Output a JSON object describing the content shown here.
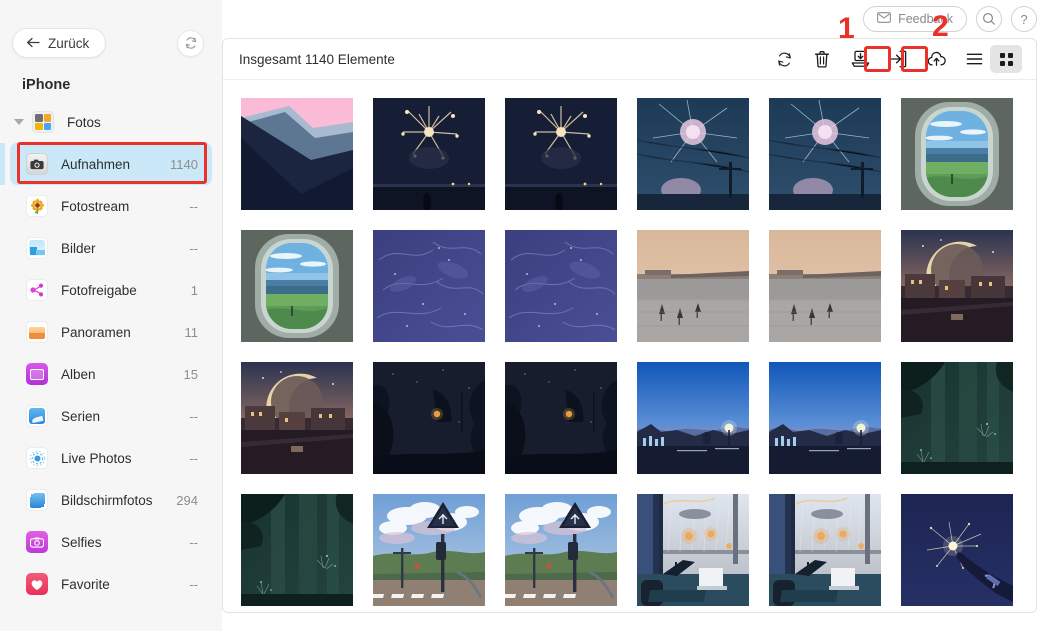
{
  "window": {
    "traffic_lights": [
      "close",
      "minimize",
      "maximize"
    ],
    "colors": {
      "close": "#fc615d",
      "minimize": "#fdbc40",
      "maximize": "#34c84a",
      "accent_selected": "#cbe8f8",
      "annotation_red": "#e8322a",
      "sidebar_bg": "#f6f6f6"
    }
  },
  "header": {
    "feedback_label": "Feedback",
    "feedback_icon": "envelope-icon",
    "search_icon": "search-icon",
    "help_icon": "help-icon"
  },
  "sidebar": {
    "back_label": "Zurück",
    "back_icon": "arrow-left-icon",
    "refresh_icon": "refresh-icon",
    "device_name": "iPhone",
    "group": {
      "label": "Fotos",
      "icon": "photos-folder-icon",
      "expanded": true
    },
    "items": [
      {
        "label": "Aufnahmen",
        "count": "1140",
        "icon": "camera-icon",
        "selected": true
      },
      {
        "label": "Fotostream",
        "count": "--",
        "icon": "sunflower-icon",
        "selected": false
      },
      {
        "label": "Bilder",
        "count": "--",
        "icon": "pictures-icon",
        "selected": false
      },
      {
        "label": "Fotofreigabe",
        "count": "1",
        "icon": "share-icon",
        "selected": false
      },
      {
        "label": "Panoramen",
        "count": "11",
        "icon": "panorama-icon",
        "selected": false
      },
      {
        "label": "Alben",
        "count": "15",
        "icon": "albums-icon",
        "selected": false
      },
      {
        "label": "Serien",
        "count": "--",
        "icon": "bursts-icon",
        "selected": false
      },
      {
        "label": "Live Photos",
        "count": "--",
        "icon": "live-photos-icon",
        "selected": false
      },
      {
        "label": "Bildschirmfotos",
        "count": "294",
        "icon": "screenshots-icon",
        "selected": false
      },
      {
        "label": "Selfies",
        "count": "--",
        "icon": "selfies-icon",
        "selected": false
      },
      {
        "label": "Favorite",
        "count": "--",
        "icon": "favorite-icon",
        "selected": false
      }
    ]
  },
  "main": {
    "title": "Insgesamt 1140 Elemente",
    "toolbar": [
      {
        "name": "refresh-icon",
        "active": false
      },
      {
        "name": "delete-icon",
        "active": false
      },
      {
        "name": "import-icon",
        "active": false
      },
      {
        "name": "export-icon",
        "active": false
      },
      {
        "name": "cloud-upload-icon",
        "active": false
      },
      {
        "name": "list-view-icon",
        "active": false
      },
      {
        "name": "grid-view-icon",
        "active": true
      }
    ],
    "photos": [
      {
        "name": "mountain-pink-sky"
      },
      {
        "name": "fireworks-over-water"
      },
      {
        "name": "fireworks-over-water"
      },
      {
        "name": "sparkler-burst-wires"
      },
      {
        "name": "sparkler-burst-wires"
      },
      {
        "name": "airplane-window-view"
      },
      {
        "name": "airplane-window-view"
      },
      {
        "name": "blue-water-texture"
      },
      {
        "name": "blue-water-texture"
      },
      {
        "name": "beach-birds-dusk"
      },
      {
        "name": "beach-birds-dusk"
      },
      {
        "name": "crescent-moon-town"
      },
      {
        "name": "crescent-moon-town"
      },
      {
        "name": "dark-forest-lantern"
      },
      {
        "name": "dark-forest-lantern"
      },
      {
        "name": "blue-hour-city"
      },
      {
        "name": "blue-hour-city"
      },
      {
        "name": "teal-forest-night"
      },
      {
        "name": "teal-forest-night"
      },
      {
        "name": "railway-crossing-sign"
      },
      {
        "name": "railway-crossing-sign"
      },
      {
        "name": "rainy-window-desk"
      },
      {
        "name": "rainy-window-desk"
      },
      {
        "name": "hand-sparkler-night"
      }
    ]
  },
  "annotations": [
    {
      "label": "1",
      "target": "import-icon"
    },
    {
      "label": "2",
      "target": "export-icon"
    },
    {
      "label": "",
      "target": "sidebar-item-aufnahmen"
    }
  ]
}
